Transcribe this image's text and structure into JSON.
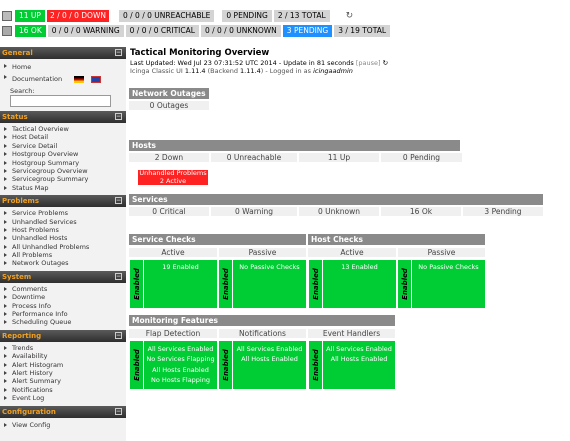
{
  "top": {
    "row1": {
      "up": "11 UP",
      "down_a": "2",
      "down_b": "0",
      "down_c": "0 DOWN",
      "unreachable": "0 / 0 / 0 UNREACHABLE",
      "pending": "0 PENDING",
      "total": "2 / 13 TOTAL"
    },
    "row2": {
      "ok": "16 OK",
      "warning": "0 / 0 / 0 WARNING",
      "critical": "0 / 0 / 0 CRITICAL",
      "unknown": "0 / 0 / 0 UNKNOWN",
      "pending": "3 PENDING",
      "total": "3 / 19 TOTAL"
    }
  },
  "sidebar": {
    "general": {
      "title": "General",
      "items": [
        "Home",
        "Documentation"
      ],
      "search_label": "Search:"
    },
    "status": {
      "title": "Status",
      "items": [
        "Tactical Overview",
        "Host Detail",
        "Service Detail",
        "Hostgroup Overview",
        "Hostgroup Summary",
        "Servicegroup Overview",
        "Servicegroup Summary",
        "Status Map"
      ]
    },
    "problems": {
      "title": "Problems",
      "items": [
        "Service Problems",
        "Unhandled Services",
        "Host Problems",
        "Unhandled Hosts",
        "All Unhandled Problems",
        "All Problems",
        "Network Outages"
      ]
    },
    "system": {
      "title": "System",
      "items": [
        "Comments",
        "Downtime",
        "Process Info",
        "Performance Info",
        "Scheduling Queue"
      ]
    },
    "reporting": {
      "title": "Reporting",
      "items": [
        "Trends",
        "Availability",
        "Alert Histogram",
        "Alert History",
        "Alert Summary",
        "Notifications",
        "Event Log"
      ]
    },
    "configuration": {
      "title": "Configuration",
      "items": [
        "View Config"
      ]
    }
  },
  "main": {
    "title": "Tactical Monitoring Overview",
    "updated": "Last Updated: Wed Jul 23 07:31:52 UTC 2014 - Update in 81 seconds",
    "pause": "[pause]",
    "version_pre": "Icinga Classic UI ",
    "version": "1.11.4",
    "backend": " (Backend ",
    "backend_version": "1.11.4",
    "logged": ") - Logged in as ",
    "user": "icingaadmin",
    "outages": {
      "title": "Network Outages",
      "value": "0 Outages"
    },
    "hosts": {
      "title": "Hosts",
      "cells": [
        "2 Down",
        "0 Unreachable",
        "11 Up",
        "0 Pending"
      ],
      "unhandled": "Unhandled Problems",
      "active": "2 Active"
    },
    "services": {
      "title": "Services",
      "cells": [
        "0 Critical",
        "0 Warning",
        "0 Unknown",
        "16 Ok",
        "3 Pending"
      ]
    },
    "service_checks": {
      "title": "Service Checks",
      "cols": [
        "Active",
        "Passive"
      ],
      "active": "19 Enabled",
      "passive": "No Passive Checks"
    },
    "host_checks": {
      "title": "Host Checks",
      "cols": [
        "Active",
        "Passive"
      ],
      "active": "13 Enabled",
      "passive": "No Passive Checks"
    },
    "features": {
      "title": "Monitoring Features",
      "cols": [
        "Flap Detection",
        "Notifications",
        "Event Handlers"
      ],
      "flap": [
        "All Services Enabled",
        "No Services Flapping",
        "All Hosts Enabled",
        "No Hosts Flapping"
      ],
      "notif": [
        "All Services Enabled",
        "All Hosts Enabled"
      ],
      "event": [
        "All Services Enabled",
        "All Hosts Enabled"
      ]
    },
    "enabled": "Enabled"
  }
}
